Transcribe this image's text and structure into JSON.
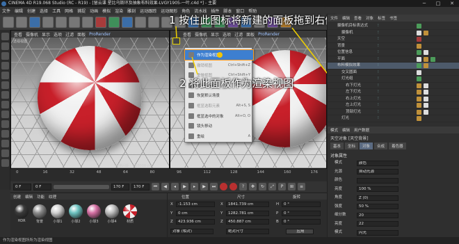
{
  "titlebar": {
    "title": "CINEMA 4D R19.068 Studio (RC - R19) - [留云课 星比乌斯环及抽象布料效果-LVGY1905-一叶.c4d *] - 主要"
  },
  "menubar": {
    "items": [
      "文件",
      "编辑",
      "创建",
      "选择",
      "工具",
      "网格",
      "捕捉",
      "动画",
      "模拟",
      "渲染",
      "雕刻",
      "运动跟踪",
      "运动图形",
      "角色",
      "流水线",
      "插件",
      "脚本",
      "窗口",
      "帮助"
    ]
  },
  "viewport_left": {
    "menu": [
      "查看",
      "摄像机",
      "显示",
      "选项",
      "过滤",
      "面板",
      "ProRender"
    ],
    "label": "透视视图",
    "footer": "网格间距：100000 cm"
  },
  "viewport_right": {
    "menu": [
      "查看",
      "摄像机",
      "显示",
      "选项",
      "过滤",
      "面板",
      "ProRender"
    ]
  },
  "popup_menu": {
    "items": [
      {
        "label": "作为渲染视图",
        "shortcut": "",
        "state": "highlight"
      },
      {
        "label": "撤销视图",
        "shortcut": "Ctrl+Shift+Z",
        "state": "disabled"
      },
      {
        "label": "重做视图",
        "shortcut": "Ctrl+Shift+Y",
        "state": "disabled"
      },
      {
        "label": "框显几何体",
        "shortcut": "Alt+H, H",
        "state": "normal"
      },
      {
        "label": "恢复默认场景",
        "shortcut": "",
        "state": "normal"
      },
      {
        "label": "框显选取元素",
        "shortcut": "Alt+S, S",
        "state": "disabled"
      },
      {
        "label": "框显选中的对象",
        "shortcut": "Alt+O, O",
        "state": "normal"
      },
      {
        "label": "镜头移动",
        "shortcut": "",
        "state": "normal"
      },
      {
        "label": "重绘",
        "shortcut": "A",
        "state": "normal"
      }
    ]
  },
  "annotations": {
    "step1": "1 按住此图标将新建的面板拖到右侧",
    "step2": "2 将此面板作为渲染视图"
  },
  "object_manager": {
    "tabs": [
      "文件",
      "编辑",
      "查看",
      "对象",
      "标签",
      "书签"
    ],
    "rows": [
      {
        "name": "摄像机目标表达式"
      },
      {
        "name": "摄像机"
      },
      {
        "name": "天空"
      },
      {
        "name": "背景"
      },
      {
        "name": "位置信息"
      },
      {
        "name": "平面"
      },
      {
        "name": "布料模拟效果"
      },
      {
        "name": "交叉圆面"
      },
      {
        "name": "灯光组"
      },
      {
        "name": "右下灯光"
      },
      {
        "name": "左下灯光"
      },
      {
        "name": "右上灯光"
      },
      {
        "name": "左上灯光"
      },
      {
        "name": "顶部灯光"
      },
      {
        "name": "灯光"
      }
    ]
  },
  "attribute_manager": {
    "tabs": [
      "模式",
      "编辑",
      "用户数据"
    ],
    "object_title": "天空对象 [天空背景]",
    "subtabs": [
      "基本",
      "坐标",
      "对象",
      "合成",
      "着色器"
    ],
    "section": "对象属性",
    "fields": [
      {
        "label": "模式",
        "value": "颜色",
        "label2": "",
        "value2": ""
      },
      {
        "label": "光源",
        "value": "自动光源",
        "label2": "",
        "value2": ""
      },
      {
        "label": "颜色",
        "value": "",
        "label2": "",
        "value2": ""
      },
      {
        "label": "亮度",
        "value": "100 %",
        "label2": "",
        "value2": ""
      },
      {
        "label": "角度",
        "value": "Z (0)",
        "label2": "",
        "value2": ""
      },
      {
        "label": "强度",
        "value": "50 %",
        "label2": "",
        "value2": ""
      },
      {
        "label": "细分数",
        "value": "20",
        "label2": "",
        "value2": ""
      },
      {
        "label": "亮度",
        "value": "22",
        "label2": "",
        "value2": ""
      },
      {
        "label": "模式",
        "value": "闪光",
        "label2": "",
        "value2": ""
      }
    ]
  },
  "timeline": {
    "ticks": [
      "0",
      "16",
      "32",
      "48",
      "64",
      "80",
      "96",
      "112",
      "128",
      "144",
      "160",
      "176"
    ]
  },
  "controls": {
    "start": "0 F",
    "current": "0 F",
    "end": "170 F",
    "end2": "170 F"
  },
  "material_manager": {
    "tabs": [
      "创建",
      "编辑",
      "功能",
      "纹理"
    ],
    "materials": [
      {
        "label": "HDR",
        "color": "#3a3a3a"
      },
      {
        "label": "背景",
        "color": "#8a8a8a"
      },
      {
        "label": "小球1",
        "color": "#cfcfcf"
      },
      {
        "label": "小球2",
        "color": "#6dc2c0"
      },
      {
        "label": "小球3",
        "color": "#d56fa3"
      },
      {
        "label": "小球4",
        "color": "#bdbdbd"
      },
      {
        "label": "材质",
        "color": "#d94050"
      }
    ]
  },
  "coordinates": {
    "headers": [
      "位置",
      "尺寸",
      "旋转"
    ],
    "rows": [
      {
        "axis": "X",
        "pos": "-1.153 cm",
        "size_axis": "X",
        "size": "1841.739 cm",
        "rot_axis": "H",
        "rot": "0 °"
      },
      {
        "axis": "Y",
        "pos": "0 cm",
        "size_axis": "Y",
        "size": "1282.781 cm",
        "rot_axis": "P",
        "rot": "0 °"
      },
      {
        "axis": "Z",
        "pos": "423.936 cm",
        "size_axis": "Z",
        "size": "450.887 cm",
        "rot_axis": "B",
        "rot": "0 °"
      }
    ],
    "mode1": "对象 (相对)",
    "mode2": "绝对尺寸",
    "apply": "应用"
  },
  "statusbar": {
    "text": "作为渲染视图所所为渲染视图"
  }
}
